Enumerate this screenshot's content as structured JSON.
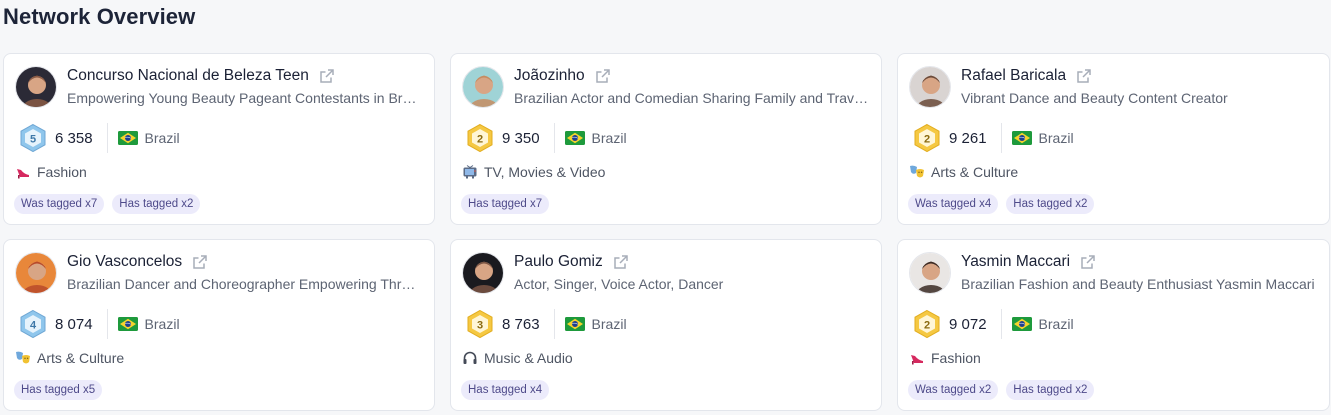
{
  "page": {
    "title": "Network Overview"
  },
  "cards": [
    {
      "name": "Concurso Nacional de Beleza Teen",
      "description": "Empowering Young Beauty Pageant Contestants in Brazil",
      "badge_level": "5",
      "followers": "6 358",
      "country": "Brazil",
      "category": "Fashion",
      "category_icon": "high-heel-icon",
      "tags": [
        "Was tagged x7",
        "Has tagged x2"
      ],
      "avatar_colors": [
        "#2b2a36",
        "#8a5a44"
      ]
    },
    {
      "name": "Joãozinho",
      "description": "Brazilian Actor and Comedian Sharing Family and Travel Moments",
      "badge_level": "2",
      "followers": "9 350",
      "country": "Brazil",
      "category": "TV, Movies & Video",
      "category_icon": "tv-icon",
      "tags": [
        "Has tagged x7"
      ],
      "avatar_colors": [
        "#9fd3d6",
        "#c58c62"
      ]
    },
    {
      "name": "Rafael Baricala",
      "description": "Vibrant Dance and Beauty Content Creator",
      "badge_level": "2",
      "followers": "9 261",
      "country": "Brazil",
      "category": "Arts & Culture",
      "category_icon": "theater-masks-icon",
      "tags": [
        "Was tagged x4",
        "Has tagged x2"
      ],
      "avatar_colors": [
        "#d9d4d2",
        "#6a4a3a"
      ]
    },
    {
      "name": "Gio Vasconcelos",
      "description": "Brazilian Dancer and Choreographer Empowering Through Movement",
      "badge_level": "4",
      "followers": "8 074",
      "country": "Brazil",
      "category": "Arts & Culture",
      "category_icon": "theater-masks-icon",
      "tags": [
        "Has tagged x5"
      ],
      "avatar_colors": [
        "#e8873a",
        "#b84a2a"
      ]
    },
    {
      "name": "Paulo Gomiz",
      "description": "Actor, Singer, Voice Actor, Dancer",
      "badge_level": "3",
      "followers": "8 763",
      "country": "Brazil",
      "category": "Music & Audio",
      "category_icon": "headphones-icon",
      "tags": [
        "Has tagged x4"
      ],
      "avatar_colors": [
        "#1a1a1f",
        "#7b5544"
      ]
    },
    {
      "name": "Yasmin Maccari",
      "description": "Brazilian Fashion and Beauty Enthusiast Yasmin Maccari",
      "badge_level": "2",
      "followers": "9 072",
      "country": "Brazil",
      "category": "Fashion",
      "category_icon": "high-heel-icon",
      "tags": [
        "Was tagged x2",
        "Has tagged x2"
      ],
      "avatar_colors": [
        "#e9e6e4",
        "#3a2a24"
      ]
    }
  ],
  "colors": {
    "badge_gold": "#f5c842",
    "badge_blue": "#8fc6ec",
    "tag_bg": "#ecebfb",
    "tag_text": "#4e4a8a"
  }
}
